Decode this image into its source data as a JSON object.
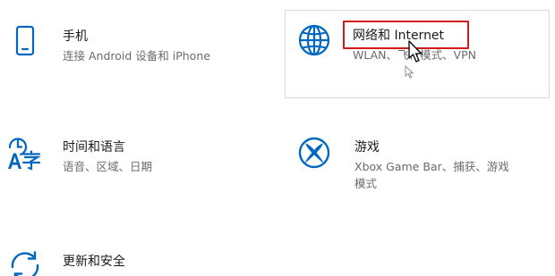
{
  "colors": {
    "accent": "#0067c0",
    "highlight": "#d11a1a",
    "title": "#1a1a1a",
    "description": "#6b6b6b",
    "hover_border": "#d9d9d9"
  },
  "tiles": [
    {
      "icon": "phone-icon",
      "title": "手机",
      "description": "连接 Android 设备和 iPhone"
    },
    {
      "icon": "globe-icon",
      "title": "网络和 Internet",
      "description": "WLAN、飞行模式、VPN",
      "state": "hovered"
    },
    {
      "icon": "time-language-icon",
      "title": "时间和语言",
      "description": "语音、区域、日期"
    },
    {
      "icon": "xbox-icon",
      "title": "游戏",
      "description_line1": "Xbox Game Bar、捕获、游戏",
      "description_line2": "模式"
    },
    {
      "icon": "update-security-icon",
      "title": "更新和安全"
    }
  ]
}
